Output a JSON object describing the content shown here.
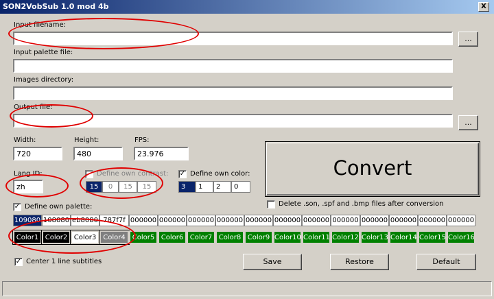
{
  "window": {
    "title": "SON2VobSub 1.0 mod 4b",
    "close": "X"
  },
  "fields": {
    "input_filename": {
      "label": "Input filename:",
      "value": ""
    },
    "input_palette": {
      "label": "Input palette file:",
      "value": ""
    },
    "images_dir": {
      "label": "Images directory:",
      "value": ""
    },
    "output_file": {
      "label": "Output file:",
      "value": ""
    },
    "browse": "..."
  },
  "video": {
    "width_label": "Width:",
    "width": "720",
    "height_label": "Height:",
    "height": "480",
    "fps_label": "FPS:",
    "fps": "23.976"
  },
  "lang": {
    "label": "Lang ID:",
    "value": "zh"
  },
  "contrast": {
    "label": "Define own contrast:",
    "checked": false,
    "values": [
      "15",
      "0",
      "15",
      "15"
    ]
  },
  "color": {
    "label": "Define own color:",
    "checked": true,
    "values": [
      "3",
      "1",
      "2",
      "0"
    ]
  },
  "convert_label": "Convert",
  "delete_label": "Delete .son, .spf and .bmp files after conversion",
  "palette": {
    "label": "Define own palette:",
    "checked": true,
    "hex": [
      "109080",
      "108080",
      "eb8080",
      "787f7f",
      "000000",
      "000000",
      "000000",
      "000000",
      "000000",
      "000000",
      "000000",
      "000000",
      "000000",
      "000000",
      "000000",
      "000000"
    ],
    "colors": [
      "Color1",
      "Color2",
      "Color3",
      "Color4",
      "Color5",
      "Color6",
      "Color7",
      "Color8",
      "Color9",
      "Color10",
      "Color11",
      "Color12",
      "Color13",
      "Color14",
      "Color15",
      "Color16"
    ]
  },
  "center_label": "Center 1 line subtitles",
  "center_checked": true,
  "buttons": {
    "save": "Save",
    "restore": "Restore",
    "default": "Default"
  },
  "colors": {
    "title_bar": "#0a246a",
    "selected": "#0a246a",
    "green": "#008000",
    "annotation": "#e00000"
  }
}
